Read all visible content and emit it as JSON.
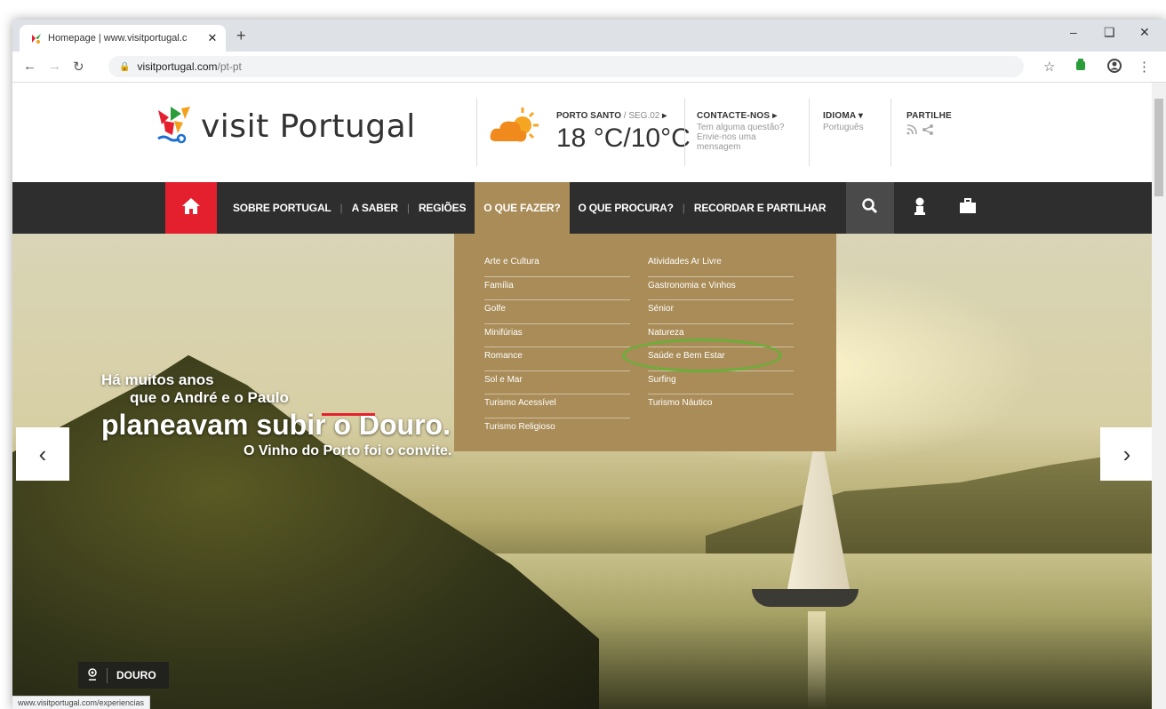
{
  "browser": {
    "tab_title": "Homepage | www.visitportugal.c",
    "tab_close": "✕",
    "new_tab": "+",
    "url_host": "visitportugal.com",
    "url_path": "/pt-pt",
    "status_url": "www.visitportugal.com/experiencias"
  },
  "header": {
    "logo_text": "visit Portugal",
    "weather": {
      "location": "PORTO SANTO",
      "date": "SEG.02",
      "temp": "18 °C/10°C"
    },
    "contact": {
      "title": "CONTACTE-NOS",
      "text_lines": [
        "Tem alguma questão?",
        "Envie-nos uma",
        "mensagem"
      ]
    },
    "language": {
      "title": "IDIOMA",
      "value": "Português"
    },
    "share": {
      "title": "PARTILHE"
    }
  },
  "menu": {
    "items": [
      {
        "label": "SOBRE PORTUGAL"
      },
      {
        "label": "A SABER"
      },
      {
        "label": "REGIÕES"
      },
      {
        "label": "O QUE FAZER?"
      },
      {
        "label": "O QUE PROCURA?"
      },
      {
        "label": "RECORDAR E PARTILHAR"
      }
    ],
    "active_index": 3
  },
  "dropdown": {
    "left_column": [
      "Arte e Cultura",
      "Família",
      "Golfe",
      "Minifúrias",
      "Romance",
      "Sol e Mar",
      "Turismo Acessível",
      "Turismo Religioso"
    ],
    "right_column": [
      "Atividades Ar Livre",
      "Gastronomia e Vinhos",
      "Sénior",
      "Natureza",
      "Saúde e Bem Estar",
      "Surfing",
      "Turismo Náutico"
    ],
    "highlighted": "Gastronomia e Vinhos",
    "highlight_color": "#6aaf3a"
  },
  "hero": {
    "line1": "Há muitos anos",
    "line2": "que o André e o Paulo",
    "line3": "planeavam subir o Douro.",
    "line4": "O Vinho do Porto foi o convite.",
    "location": "DOURO",
    "prev": "‹",
    "next": "›"
  },
  "colors": {
    "brand_red": "#e5202e",
    "menu_bg": "#2e2e2e",
    "dropdown_bg": "#a98c57"
  }
}
